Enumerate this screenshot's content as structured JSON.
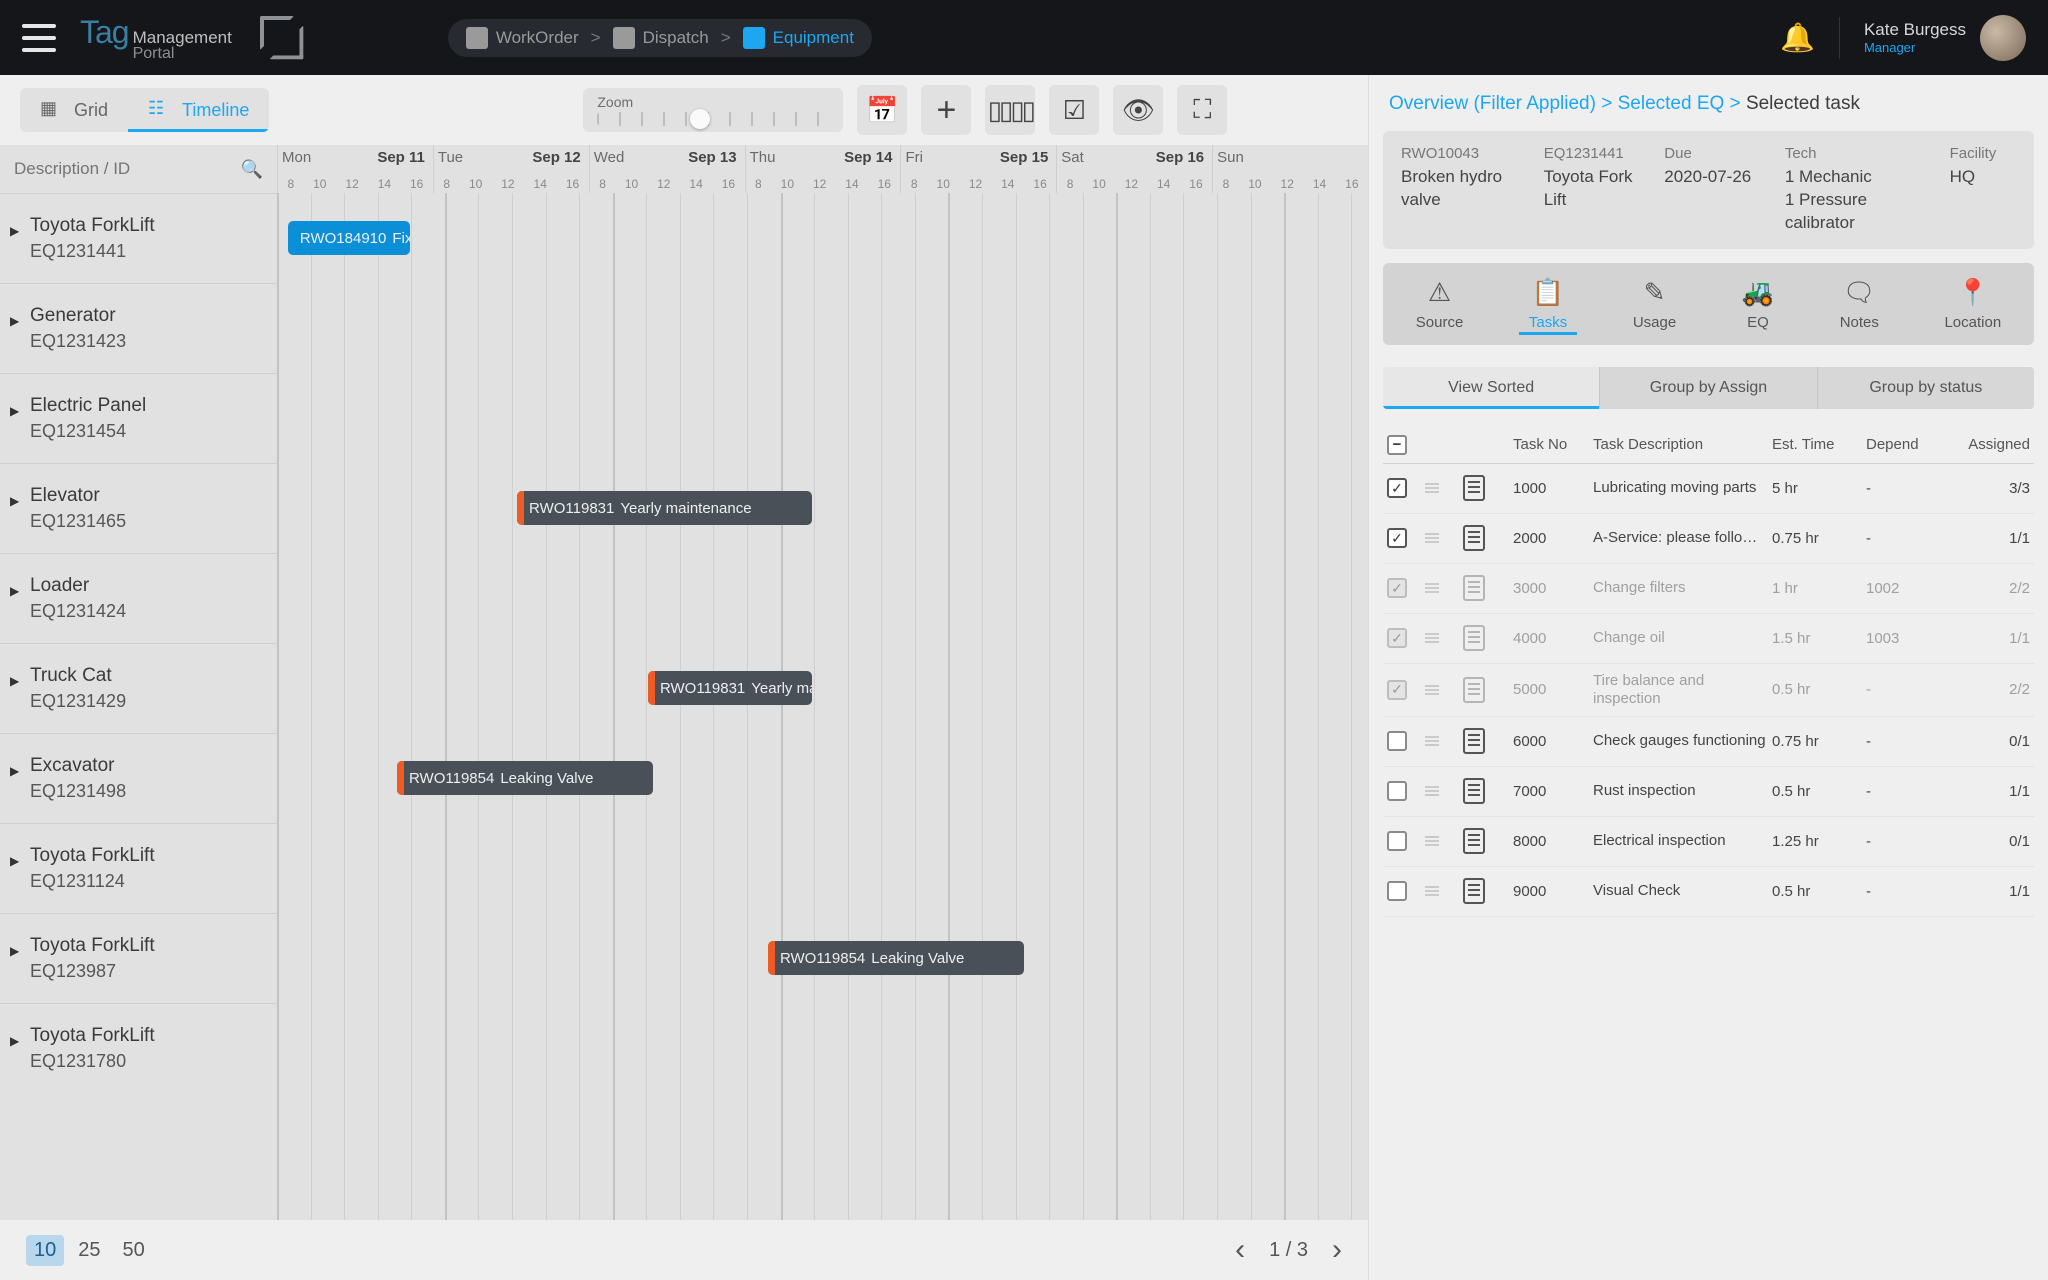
{
  "header": {
    "app_tag": "Tag",
    "app_line1": "Management",
    "app_line2": "Portal",
    "breadcrumbs": [
      {
        "label": "WorkOrder",
        "active": false
      },
      {
        "label": "Dispatch",
        "active": false
      },
      {
        "label": "Equipment",
        "active": true
      }
    ],
    "user": {
      "name": "Kate Burgess",
      "role": "Manager"
    }
  },
  "toolbar": {
    "grid_label": "Grid",
    "timeline_label": "Timeline",
    "zoom_label": "Zoom",
    "zoom_pct": 40
  },
  "searchPlaceholder": "Description / ID",
  "timeline": {
    "days": [
      {
        "dow": "Mon",
        "date": "Sep 11"
      },
      {
        "dow": "Tue",
        "date": "Sep 12"
      },
      {
        "dow": "Wed",
        "date": "Sep 13"
      },
      {
        "dow": "Thu",
        "date": "Sep 14"
      },
      {
        "dow": "Fri",
        "date": "Sep 15"
      },
      {
        "dow": "Sat",
        "date": "Sep 16"
      },
      {
        "dow": "Sun",
        "date": ""
      }
    ],
    "hour_ticks": [
      "8",
      "10",
      "12",
      "14",
      "16"
    ]
  },
  "equipment": [
    {
      "name": "Toyota ForkLift",
      "id": "EQ1231441"
    },
    {
      "name": "Generator",
      "id": "EQ1231423"
    },
    {
      "name": "Electric Panel",
      "id": "EQ1231454"
    },
    {
      "name": "Elevator",
      "id": "EQ1231465"
    },
    {
      "name": "Loader",
      "id": "EQ1231424"
    },
    {
      "name": "Truck Cat",
      "id": "EQ1231429"
    },
    {
      "name": "Excavator",
      "id": "EQ1231498"
    },
    {
      "name": "Toyota ForkLift",
      "id": "EQ1231124"
    },
    {
      "name": "Toyota ForkLift",
      "id": "EQ123987"
    },
    {
      "name": "Toyota ForkLift",
      "id": "EQ1231780"
    }
  ],
  "bars": [
    {
      "row": 0,
      "code": "RWO184910",
      "text": "Fixi…",
      "style": "blue",
      "left_pct": 1,
      "width_pct": 11.2
    },
    {
      "row": 3,
      "code": "RWO119831",
      "text": "Yearly maintenance",
      "style": "dk",
      "stripe": true,
      "left_pct": 22,
      "width_pct": 27
    },
    {
      "row": 5,
      "code": "RWO119831",
      "text": "Yearly ma",
      "style": "dk",
      "stripe": true,
      "left_pct": 34,
      "width_pct": 15
    },
    {
      "row": 6,
      "code": "RWO119854",
      "text": "Leaking Valve",
      "style": "dk",
      "stripe": true,
      "left_pct": 11,
      "width_pct": 23.5
    },
    {
      "row": 8,
      "code": "RWO119854",
      "text": "Leaking Valve",
      "style": "dk",
      "stripe": true,
      "left_pct": 45,
      "width_pct": 23.5
    }
  ],
  "pager": {
    "sizes": [
      "10",
      "25",
      "50"
    ],
    "selected": "10",
    "page_display": "1 / 3"
  },
  "detail": {
    "crumb": [
      {
        "label": "Overview (Filter Applied)"
      },
      {
        "label": "Selected EQ"
      },
      {
        "label": "Selected task",
        "current": true
      }
    ],
    "fields": {
      "rwo_id": "RWO10043",
      "rwo_desc": "Broken hydro valve",
      "eq_id": "EQ1231441",
      "eq_desc": "Toyota Fork Lift",
      "due_label": "Due",
      "due": "2020-07-26",
      "tech_label": "Tech",
      "tech": "1 Mechanic\n1 Pressure calibrator",
      "fac_label": "Facility",
      "fac": "HQ"
    },
    "tabs": [
      {
        "label": "Source",
        "icon": "⚠"
      },
      {
        "label": "Tasks",
        "icon": "📋",
        "active": true
      },
      {
        "label": "Usage",
        "icon": "✎"
      },
      {
        "label": "EQ",
        "icon": "🚜"
      },
      {
        "label": "Notes",
        "icon": "🗨"
      },
      {
        "label": "Location",
        "icon": "📍"
      }
    ],
    "group_buttons": [
      "View Sorted",
      "Group by Assign",
      "Group by status"
    ],
    "group_active": 0,
    "task_headers": {
      "no": "Task No",
      "desc": "Task Description",
      "est": "Est. Time",
      "dep": "Depend",
      "asg": "Assigned"
    },
    "tasks": [
      {
        "no": "1000",
        "desc": "Lubricating moving parts",
        "est": "5 hr",
        "dep": "-",
        "asg": "3/3",
        "chk": true
      },
      {
        "no": "2000",
        "desc": "A-Service: please follo…",
        "est": "0.75 hr",
        "dep": "-",
        "asg": "1/1",
        "chk": true
      },
      {
        "no": "3000",
        "desc": "Change filters",
        "est": "1 hr",
        "dep": "1002",
        "asg": "2/2",
        "chk": true,
        "dim": true
      },
      {
        "no": "4000",
        "desc": "Change oil",
        "est": "1.5 hr",
        "dep": "1003",
        "asg": "1/1",
        "chk": true,
        "dim": true
      },
      {
        "no": "5000",
        "desc": "Tire balance and inspection",
        "est": "0.5 hr",
        "dep": "-",
        "asg": "2/2",
        "chk": true,
        "dim": true
      },
      {
        "no": "6000",
        "desc": "Check gauges functioning",
        "est": "0.75 hr",
        "dep": "-",
        "asg": "0/1",
        "chk": false
      },
      {
        "no": "7000",
        "desc": "Rust inspection",
        "est": "0.5 hr",
        "dep": "-",
        "asg": "1/1",
        "chk": false
      },
      {
        "no": "8000",
        "desc": "Electrical inspection",
        "est": "1.25 hr",
        "dep": "-",
        "asg": "0/1",
        "chk": false
      },
      {
        "no": "9000",
        "desc": "Visual Check",
        "est": "0.5 hr",
        "dep": "-",
        "asg": "1/1",
        "chk": false
      }
    ]
  }
}
